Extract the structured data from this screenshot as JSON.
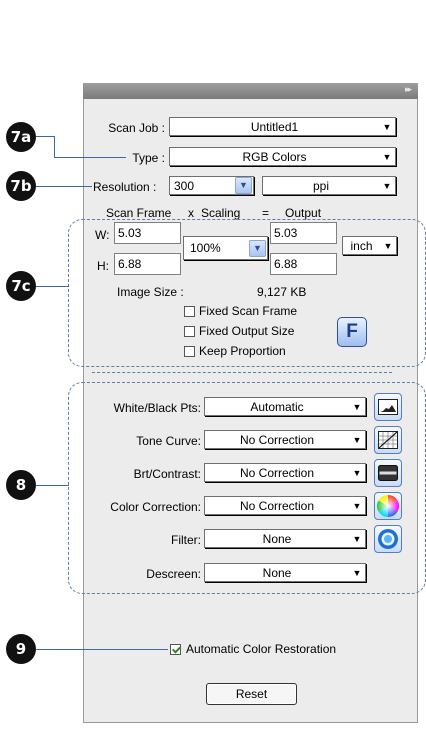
{
  "panel": {
    "scan_job": {
      "label": "Scan Job :",
      "value": "Untitled1"
    },
    "type": {
      "label": "Type :",
      "value": "RGB Colors"
    },
    "resolution": {
      "label": "Resolution :",
      "value": "300",
      "unit": "ppi"
    },
    "frame_header": {
      "scan_frame": "Scan Frame",
      "x": "x",
      "scaling": "Scaling",
      "eq": "=",
      "output": "Output"
    },
    "w": {
      "label": "W:",
      "value": "5.03",
      "output": "5.03"
    },
    "h": {
      "label": "H:",
      "value": "6.88",
      "output": "6.88"
    },
    "scaling_value": "100%",
    "size_unit": "inch",
    "image_size": {
      "label": "Image Size :",
      "value": "9,127 KB"
    },
    "checks": {
      "fixed_scan_frame": {
        "label": "Fixed Scan Frame",
        "checked": false
      },
      "fixed_output_size": {
        "label": "Fixed Output Size",
        "checked": false
      },
      "keep_proportion": {
        "label": "Keep Proportion",
        "checked": false
      }
    },
    "f_button": "F",
    "corrections": [
      {
        "label": "White/Black Pts:",
        "value": "Automatic",
        "icon": "histogram-icon"
      },
      {
        "label": "Tone Curve:",
        "value": "No Correction",
        "icon": "tone-curve-icon"
      },
      {
        "label": "Brt/Contrast:",
        "value": "No Correction",
        "icon": "brightness-contrast-icon"
      },
      {
        "label": "Color Correction:",
        "value": "No Correction",
        "icon": "color-wheel-icon"
      },
      {
        "label": "Filter:",
        "value": "None",
        "icon": "filter-lens-icon"
      },
      {
        "label": "Descreen:",
        "value": "None",
        "icon": ""
      }
    ],
    "auto_color_restoration": {
      "label": "Automatic Color Restoration",
      "checked": true
    },
    "reset_label": "Reset"
  },
  "callouts": {
    "c7a": "7a",
    "c7b": "7b",
    "c7c": "7c",
    "c8": "8",
    "c9": "9"
  },
  "colors": {
    "dash": "#5b7fa8",
    "panel": "#ececec",
    "titlebar": "#8a8a8a",
    "marker": "#111111",
    "accent_blue": "#4f7fc4"
  }
}
